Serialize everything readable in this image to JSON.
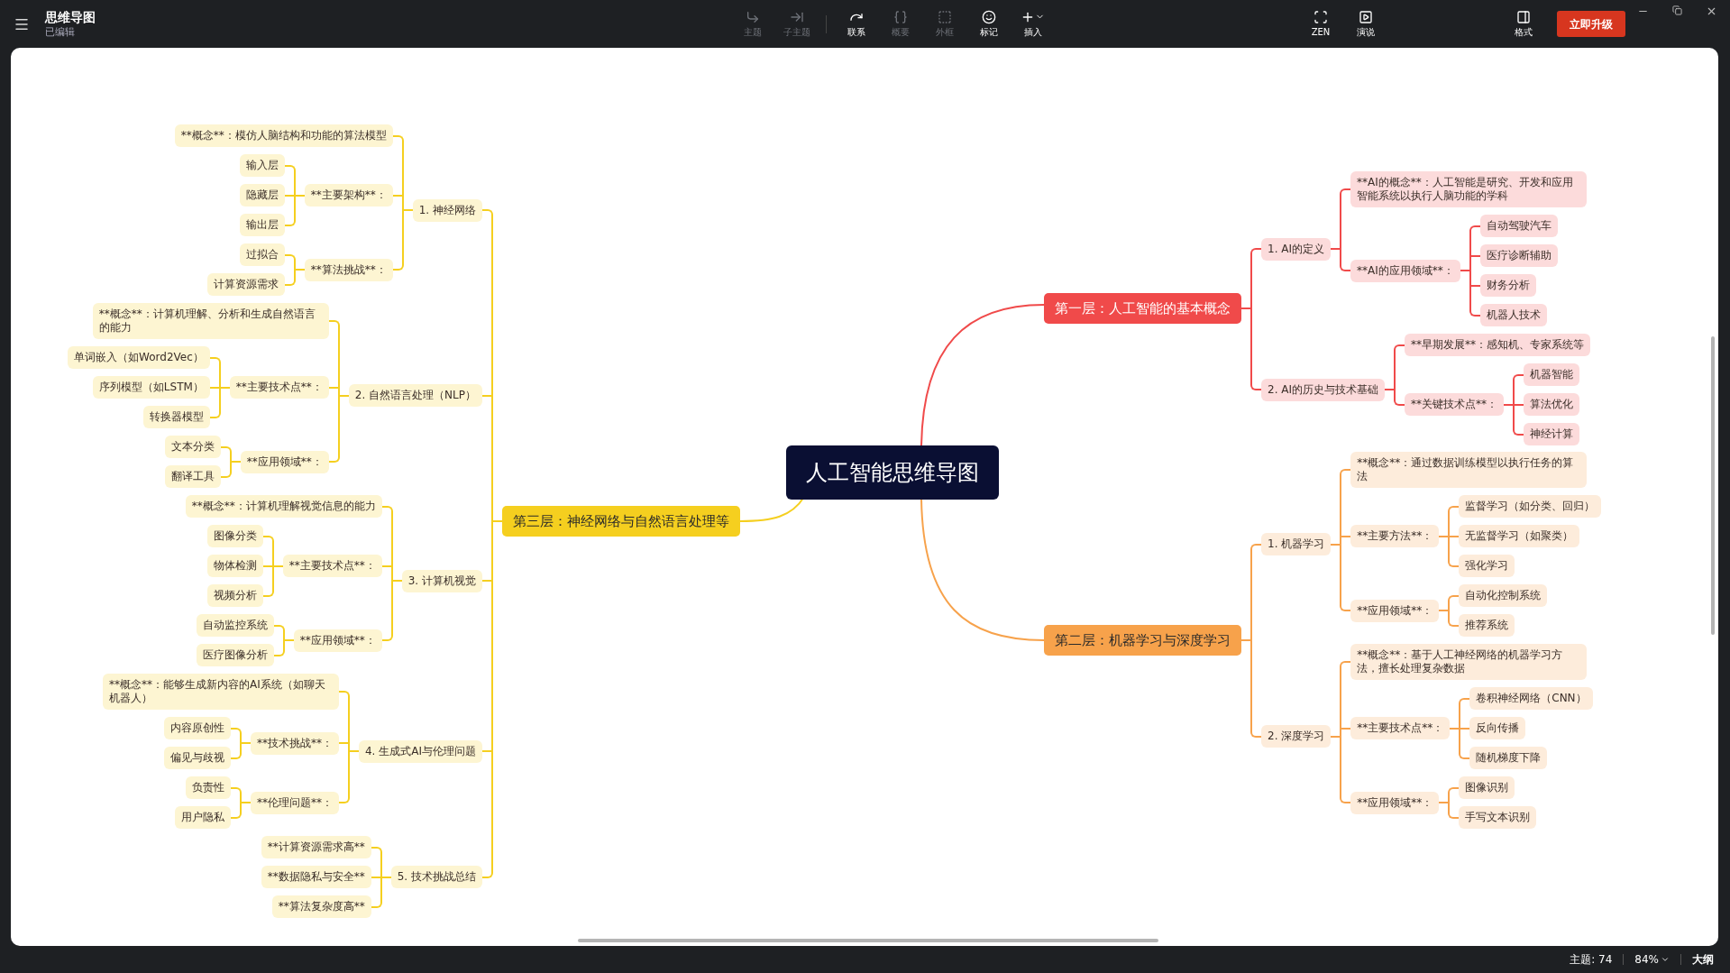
{
  "app": {
    "title": "思维导图",
    "status": "已编辑"
  },
  "toolbar": [
    {
      "label": "主题",
      "disabled": true
    },
    {
      "label": "子主题",
      "disabled": true
    },
    {
      "label": "联系",
      "disabled": false
    },
    {
      "label": "概要",
      "disabled": true
    },
    {
      "label": "外框",
      "disabled": true
    },
    {
      "label": "标记",
      "disabled": false
    },
    {
      "label": "插入",
      "disabled": false
    }
  ],
  "view_buttons": [
    {
      "label": "ZEN"
    },
    {
      "label": "演说"
    }
  ],
  "format_button": "格式",
  "upgrade_button": "立即升级",
  "mind_map": {
    "root": "人工智能思维导图",
    "right_branches": [
      {
        "label": "第一层：人工智能的基本概念",
        "color": "#f04a4a",
        "children": [
          {
            "label": "1. AI的定义",
            "children": [
              {
                "label": "**AI的概念**：人工智能是研究、开发和应用智能系统以执行人脑功能的学科"
              },
              {
                "label": "**AI的应用领域**：",
                "children": [
                  {
                    "label": "自动驾驶汽车"
                  },
                  {
                    "label": "医疗诊断辅助"
                  },
                  {
                    "label": "财务分析"
                  },
                  {
                    "label": "机器人技术"
                  }
                ]
              }
            ]
          },
          {
            "label": "2. AI的历史与技术基础",
            "children": [
              {
                "label": "**早期发展**：感知机、专家系统等"
              },
              {
                "label": "**关键技术点**：",
                "children": [
                  {
                    "label": "机器智能"
                  },
                  {
                    "label": "算法优化"
                  },
                  {
                    "label": "神经计算"
                  }
                ]
              }
            ]
          }
        ]
      },
      {
        "label": "第二层：机器学习与深度学习",
        "color": "#f7a24b",
        "children": [
          {
            "label": "1. 机器学习",
            "children": [
              {
                "label": "**概念**：通过数据训练模型以执行任务的算法"
              },
              {
                "label": "**主要方法**：",
                "children": [
                  {
                    "label": "监督学习（如分类、回归）"
                  },
                  {
                    "label": "无监督学习（如聚类）"
                  },
                  {
                    "label": "强化学习"
                  }
                ]
              },
              {
                "label": "**应用领域**：",
                "children": [
                  {
                    "label": "自动化控制系统"
                  },
                  {
                    "label": "推荐系统"
                  }
                ]
              }
            ]
          },
          {
            "label": "2. 深度学习",
            "children": [
              {
                "label": "**概念**：基于人工神经网络的机器学习方法，擅长处理复杂数据"
              },
              {
                "label": "**主要技术点**：",
                "children": [
                  {
                    "label": "卷积神经网络（CNN）"
                  },
                  {
                    "label": "反向传播"
                  },
                  {
                    "label": "随机梯度下降"
                  }
                ]
              },
              {
                "label": "**应用领域**：",
                "children": [
                  {
                    "label": "图像识别"
                  },
                  {
                    "label": "手写文本识别"
                  }
                ]
              }
            ]
          }
        ]
      }
    ],
    "left_branches": [
      {
        "label": "第三层：神经网络与自然语言处理等",
        "color": "#f5cf1f",
        "children": [
          {
            "label": "1. 神经网络",
            "children": [
              {
                "label": "**概念**：模仿人脑结构和功能的算法模型"
              },
              {
                "label": "**主要架构**：",
                "children": [
                  {
                    "label": "输入层"
                  },
                  {
                    "label": "隐藏层"
                  },
                  {
                    "label": "输出层"
                  }
                ]
              },
              {
                "label": "**算法挑战**：",
                "children": [
                  {
                    "label": "过拟合"
                  },
                  {
                    "label": "计算资源需求"
                  }
                ]
              }
            ]
          },
          {
            "label": "2. 自然语言处理（NLP）",
            "children": [
              {
                "label": "**概念**：计算机理解、分析和生成自然语言的能力"
              },
              {
                "label": "**主要技术点**：",
                "children": [
                  {
                    "label": "单词嵌入（如Word2Vec）"
                  },
                  {
                    "label": "序列模型（如LSTM）"
                  },
                  {
                    "label": "转换器模型"
                  }
                ]
              },
              {
                "label": "**应用领域**：",
                "children": [
                  {
                    "label": "文本分类"
                  },
                  {
                    "label": "翻译工具"
                  }
                ]
              }
            ]
          },
          {
            "label": "3. 计算机视觉",
            "children": [
              {
                "label": "**概念**：计算机理解视觉信息的能力"
              },
              {
                "label": "**主要技术点**：",
                "children": [
                  {
                    "label": "图像分类"
                  },
                  {
                    "label": "物体检测"
                  },
                  {
                    "label": "视频分析"
                  }
                ]
              },
              {
                "label": "**应用领域**：",
                "children": [
                  {
                    "label": "自动监控系统"
                  },
                  {
                    "label": "医疗图像分析"
                  }
                ]
              }
            ]
          },
          {
            "label": "4. 生成式AI与伦理问题",
            "children": [
              {
                "label": "**概念**：能够生成新内容的AI系统（如聊天机器人）"
              },
              {
                "label": "**技术挑战**：",
                "children": [
                  {
                    "label": "内容原创性"
                  },
                  {
                    "label": "偏见与歧视"
                  }
                ]
              },
              {
                "label": "**伦理问题**：",
                "children": [
                  {
                    "label": "负责性"
                  },
                  {
                    "label": "用户隐私"
                  }
                ]
              }
            ]
          },
          {
            "label": "5. 技术挑战总结",
            "children": [
              {
                "label": "**计算资源需求高**"
              },
              {
                "label": "**数据隐私与安全**"
              },
              {
                "label": "**算法复杂度高**"
              }
            ]
          }
        ]
      }
    ]
  },
  "status_bar": {
    "topics": "主题: 74",
    "zoom": "84%",
    "outline": "大纲"
  }
}
